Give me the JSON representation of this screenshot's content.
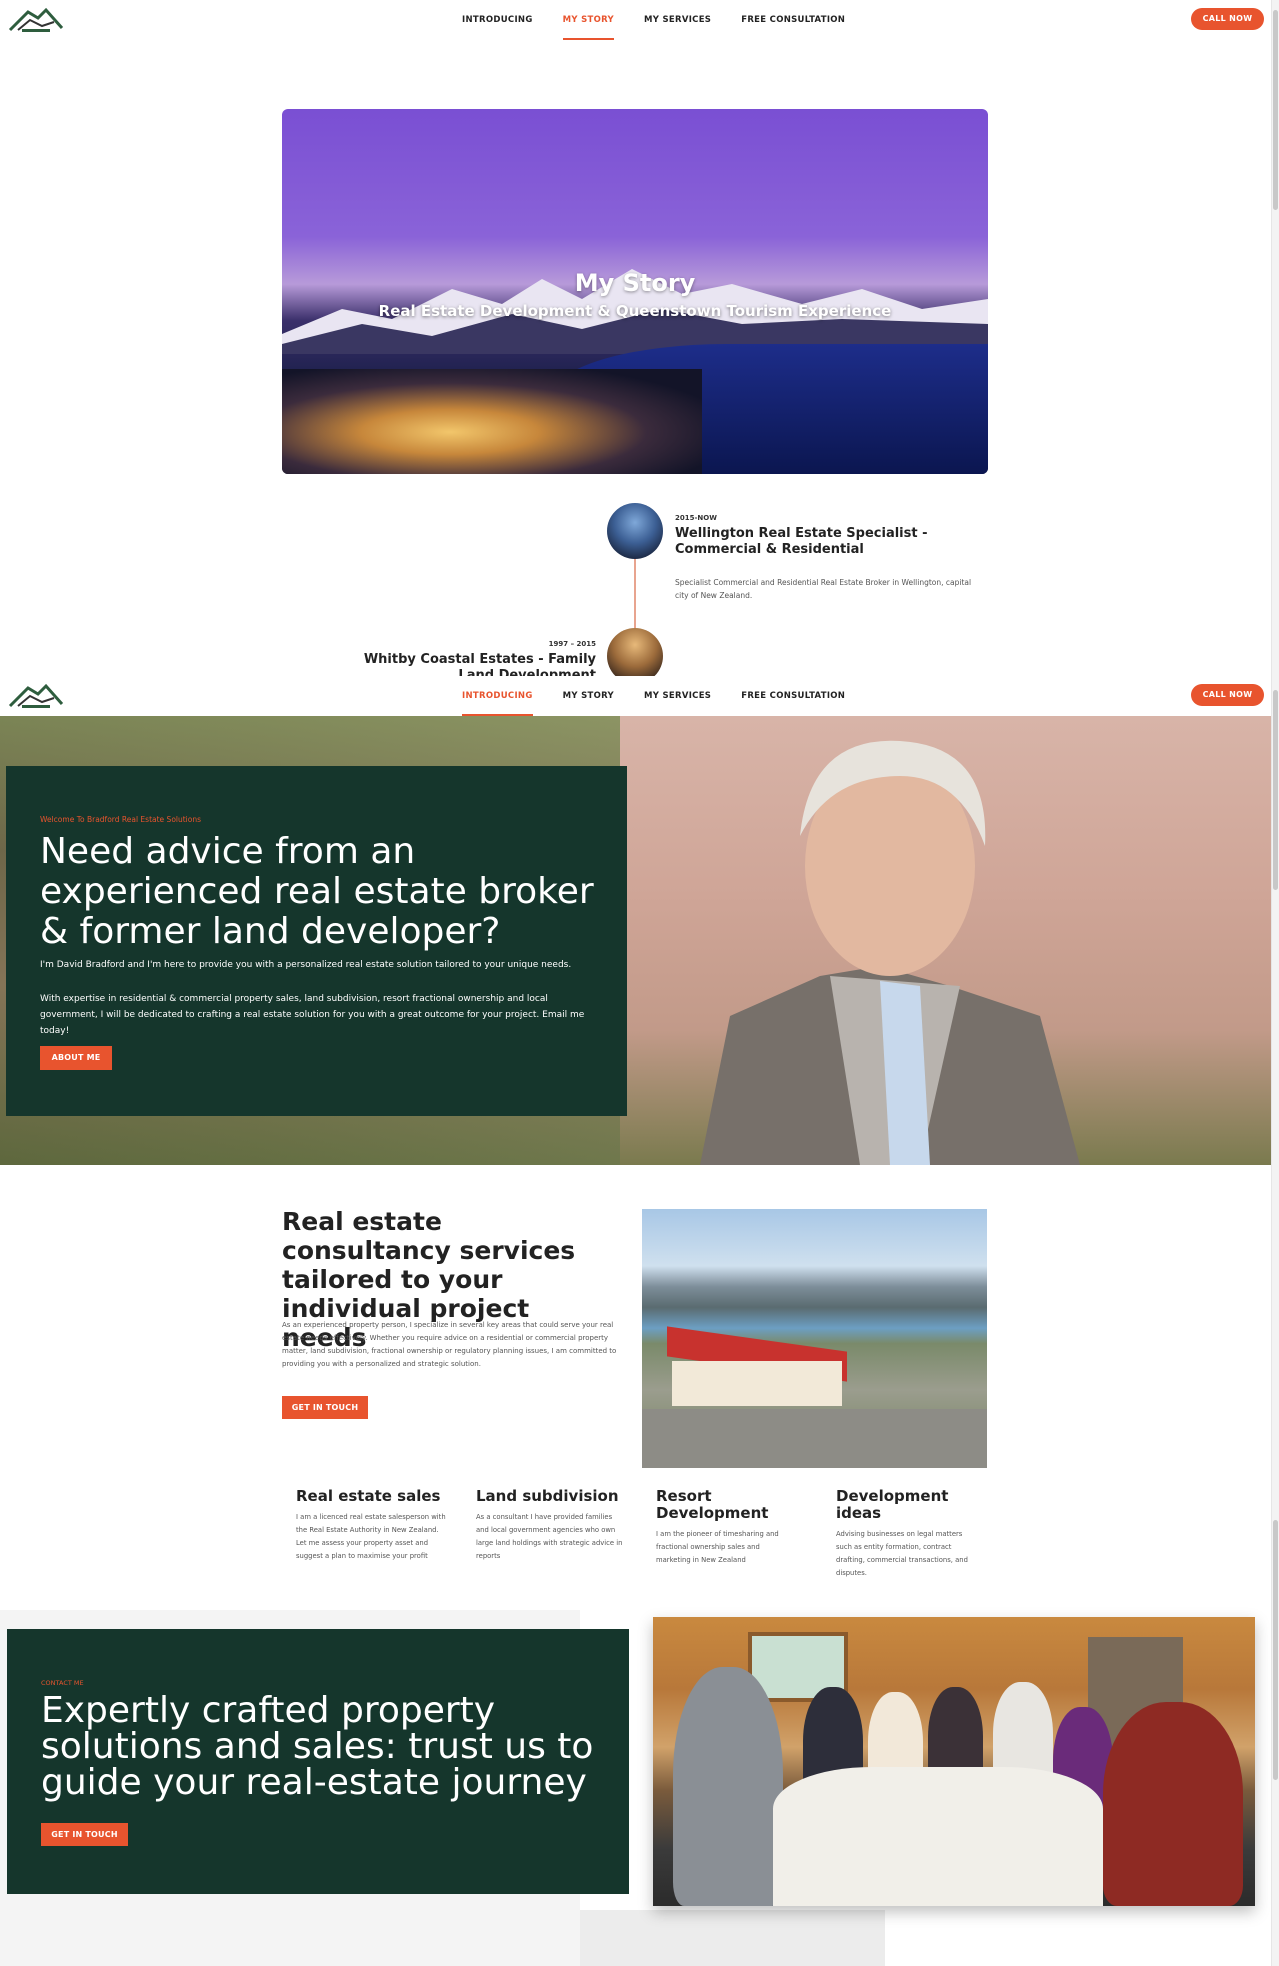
{
  "top_header": {
    "nav": [
      "INTRODUCING",
      "MY STORY",
      "MY SERVICES",
      "FREE CONSULTATION"
    ],
    "active_index": 1,
    "call_label": "CALL NOW"
  },
  "story": {
    "title": "My Story",
    "subtitle": "Real Estate Development & Queenstown Tourism Experience"
  },
  "timeline": [
    {
      "years": "2015-NOW",
      "title": "Wellington Real Estate Specialist - Commercial & Residential",
      "description": "Specialist Commercial and Residential Real Estate Broker in Wellington, capital city of New Zealand."
    },
    {
      "years": "1997 – 2015",
      "title": "Whitby Coastal Estates - Family Land Development"
    }
  ],
  "second_header": {
    "nav": [
      "INTRODUCING",
      "MY STORY",
      "MY SERVICES",
      "FREE CONSULTATION"
    ],
    "active_index": 0,
    "call_label": "CALL NOW"
  },
  "intro": {
    "eyebrow": "Welcome To Bradford Real Estate Solutions",
    "headline": "Need advice from an experienced  real estate broker & former land developer?",
    "p1": "I'm David Bradford and I'm here to provide you with a personalized real estate solution tailored to your unique needs.",
    "p2": "With expertise in residential & commercial property sales, land subdivision, resort fractional ownership and local government, I will be dedicated to crafting a real estate solution for you with a great outcome for your project.  Email me today!",
    "button": "ABOUT ME"
  },
  "consultancy": {
    "title": "Real estate consultancy services tailored to your individual project needs",
    "text": "As an experienced property person, I specialize in several key areas that could serve your real estate needs effectively. Whether you require advice on a residential or commercial property matter, land subdivision, fractional ownership or  regulatory planning issues, I am committed to providing you with a personalized and strategic solution.",
    "button": "GET IN TOUCH"
  },
  "services": [
    {
      "title": "Real estate sales",
      "text": "I am a licenced real estate salesperson with the Real Estate Authority in New Zealand. Let me assess your property asset and suggest a plan to maximise your profit"
    },
    {
      "title": "Land subdivision",
      "text": "As a consultant I have provided families and local government agencies who own large land holdings with strategic advice in reports"
    },
    {
      "title": "Resort Development",
      "text": "I am the pioneer of timesharing and fractional ownership sales and marketing in New Zealand"
    },
    {
      "title": "Development ideas",
      "text": "Advising businesses on legal matters such as entity formation, contract drafting, commercial transactions, and disputes."
    }
  ],
  "contact": {
    "eyebrow": "CONTACT ME",
    "headline": "Expertly crafted property solutions and sales: trust us to guide your real-estate journey",
    "button": "GET IN TOUCH"
  },
  "colors": {
    "accent": "#e8542e",
    "dark_green": "#15362c"
  }
}
